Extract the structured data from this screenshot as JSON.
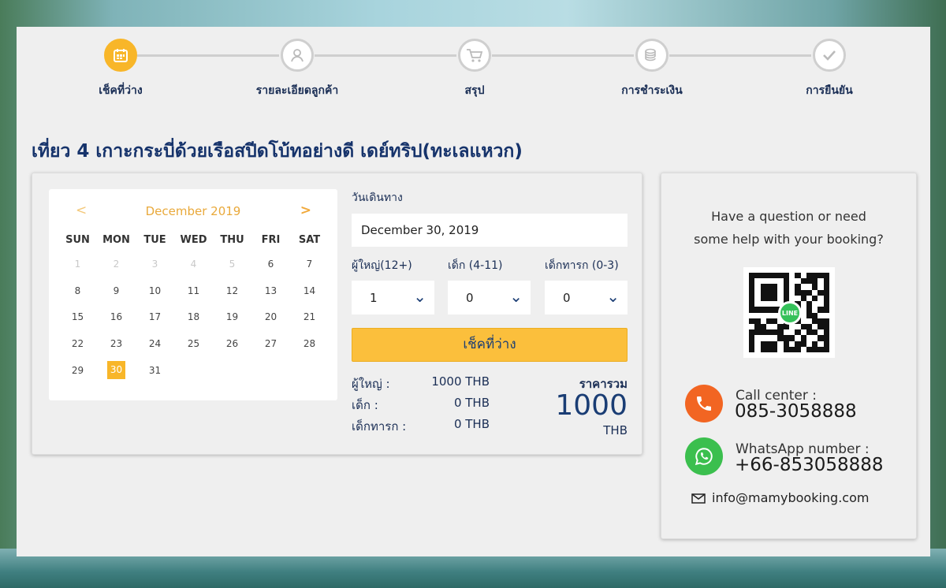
{
  "steps": [
    {
      "label": "เช็คที่ว่าง",
      "icon": "calendar-icon",
      "active": true
    },
    {
      "label": "รายละเอียดลูกค้า",
      "icon": "user-icon",
      "active": false
    },
    {
      "label": "สรุป",
      "icon": "cart-icon",
      "active": false
    },
    {
      "label": "การชำระเงิน",
      "icon": "coins-icon",
      "active": false
    },
    {
      "label": "การยืนยัน",
      "icon": "check-icon",
      "active": false
    }
  ],
  "title": "เที่ยว 4 เกาะกระบี่ด้วยเรือสปีดโบ้ทอย่างดี เดย์ทริป(ทะเลแหวก)",
  "calendar": {
    "month": "December 2019",
    "prev": "<",
    "next": ">",
    "weekdays": [
      "SUN",
      "MON",
      "TUE",
      "WED",
      "THU",
      "FRI",
      "SAT"
    ],
    "weeks": [
      [
        "1",
        "2",
        "3",
        "4",
        "5",
        "6",
        "7"
      ],
      [
        "8",
        "9",
        "10",
        "11",
        "12",
        "13",
        "14"
      ],
      [
        "15",
        "16",
        "17",
        "18",
        "19",
        "20",
        "21"
      ],
      [
        "22",
        "23",
        "24",
        "25",
        "26",
        "27",
        "28"
      ],
      [
        "29",
        "30",
        "31",
        "",
        "",
        "",
        ""
      ]
    ],
    "disabled_through": 5,
    "selected": "30"
  },
  "booking": {
    "date_label": "วันเดินทาง",
    "date_value": "December 30, 2019",
    "adult_label": "ผู้ใหญ่(12+)",
    "child_label": "เด็ก (4-11)",
    "infant_label": "เด็กทารก (0-3)",
    "adult_value": "1",
    "child_value": "0",
    "infant_value": "0",
    "check_button": "เช็คที่ว่าง",
    "price_adult_label": "ผู้ใหญ่ :",
    "price_child_label": "เด็ก :",
    "price_infant_label": "เด็กทารก :",
    "price_adult": "1000 THB",
    "price_child": "0 THB",
    "price_infant": "0 THB",
    "total_label": "ราคารวม",
    "total_value": "1000",
    "total_currency": "THB"
  },
  "help": {
    "question_line1": "Have a question or need",
    "question_line2": "some help with your booking?",
    "qr_logo": "LINE",
    "call_label": "Call center :",
    "call_number": "085-3058888",
    "whatsapp_label": "WhatsApp number :",
    "whatsapp_number": "+66-853058888",
    "email": "info@mamybooking.com"
  },
  "colors": {
    "accent": "#f8b629",
    "navy": "#16336b",
    "call": "#f26522",
    "whatsapp": "#3bbf4e"
  }
}
